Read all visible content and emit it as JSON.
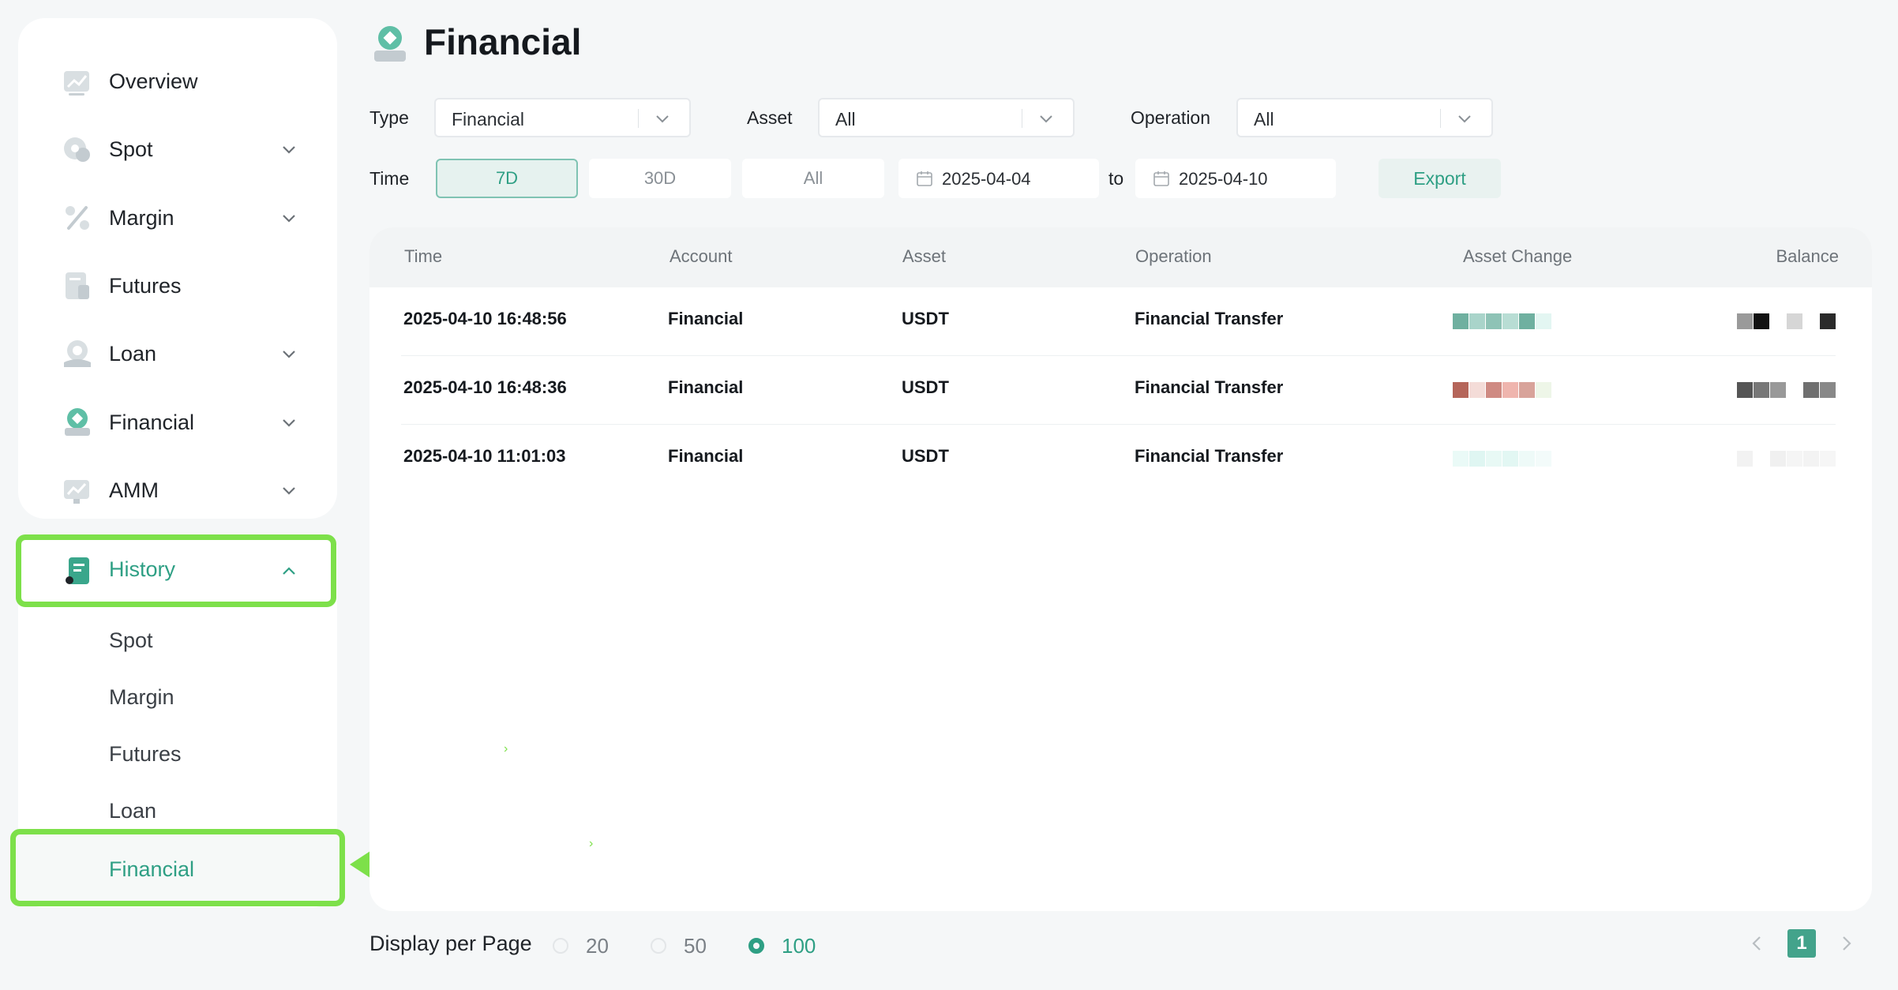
{
  "sidebar": {
    "items": [
      {
        "label": "Overview",
        "icon": "chart-icon"
      },
      {
        "label": "Spot",
        "icon": "coin-icon"
      },
      {
        "label": "Margin",
        "icon": "percent-icon"
      },
      {
        "label": "Futures",
        "icon": "document-icon"
      },
      {
        "label": "Loan",
        "icon": "loan-icon"
      },
      {
        "label": "Financial",
        "icon": "financial-icon"
      },
      {
        "label": "AMM",
        "icon": "amm-icon"
      }
    ],
    "history": {
      "label": "History",
      "icon": "history-icon",
      "subitems": [
        "Spot",
        "Margin",
        "Futures",
        "Loan",
        "Financial"
      ],
      "active": "Financial"
    }
  },
  "page": {
    "title": "Financial",
    "icon": "financial-icon"
  },
  "filters": {
    "type_label": "Type",
    "type_value": "Financial",
    "asset_label": "Asset",
    "asset_value": "All",
    "operation_label": "Operation",
    "operation_value": "All",
    "time_label": "Time",
    "time_options": [
      "7D",
      "30D",
      "All"
    ],
    "time_active": "7D",
    "date_from": "2025-04-04",
    "date_to_label": "to",
    "date_to": "2025-04-10",
    "export_label": "Export"
  },
  "table": {
    "headers": [
      "Time",
      "Account",
      "Asset",
      "Operation",
      "Asset Change",
      "Balance"
    ],
    "rows": [
      {
        "time": "2025-04-10 16:48:56",
        "account": "Financial",
        "asset": "USDT",
        "operation": "Financial Transfer"
      },
      {
        "time": "2025-04-10 16:48:36",
        "account": "Financial",
        "asset": "USDT",
        "operation": "Financial Transfer"
      },
      {
        "time": "2025-04-10 11:01:03",
        "account": "Financial",
        "asset": "USDT",
        "operation": "Financial Transfer"
      }
    ]
  },
  "pagination": {
    "per_page_label": "Display per Page",
    "options": [
      "20",
      "50",
      "100"
    ],
    "selected": "100",
    "current_page": "1"
  },
  "colors": {
    "accent": "#2e9f84",
    "highlight": "#7de04a",
    "background": "#f5f7f8"
  }
}
